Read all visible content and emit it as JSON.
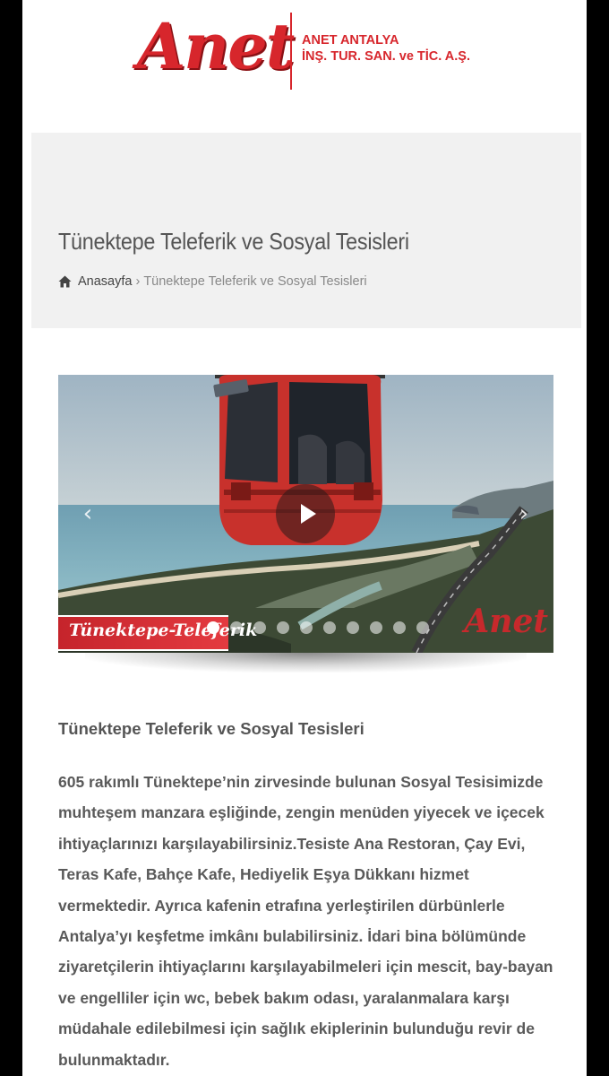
{
  "header": {
    "logo_word": "Anet",
    "company_line1": "ANET ANTALYA",
    "company_line2": "İNŞ. TUR. SAN. ve TİC. A.Ş."
  },
  "title_band": {
    "title": "Tünektepe Teleferik ve Sosyal Tesisleri",
    "breadcrumb": {
      "home_label": "Anasayfa",
      "separator": "›",
      "current": "Tünektepe Teleferik ve Sosyal Tesisleri"
    }
  },
  "slider": {
    "caption": "Tünektepe-Teleferik",
    "watermark": "Anet",
    "prev_glyph": "‹",
    "next_glyph": "›",
    "dot_count": 10,
    "active_dot": 1
  },
  "content": {
    "heading": "Tünektepe Teleferik ve Sosyal Tesisleri",
    "body": "605 rakımlı Tünektepe’nin zirvesinde bulunan Sosyal Tesisimizde muhteşem manzara eşliğinde, zengin menüden yiyecek ve içecek ihtiyaçlarınızı karşılayabilirsiniz.Tesiste Ana Restoran, Çay Evi, Teras Kafe, Bahçe Kafe, Hediyelik Eşya Dükkanı hizmet vermektedir. Ayrıca kafenin etrafına yerleştirilen dürbünlerle Antalya’yı keşfetme imkânı bulabilirsiniz. İdari bina bölümünde ziyaretçilerin ihtiyaçlarını karşılayabilmeleri için mescit, bay-bayan ve engelliler için wc, bebek bakım odası, yaralanmalara karşı müdahale edilebilmesi için sağlık ekiplerinin bulunduğu revir de bulunmaktadır."
  },
  "colors": {
    "brand_red": "#d7262c",
    "text_gray": "#5a5a5a",
    "band_bg": "#f1f1f1"
  }
}
